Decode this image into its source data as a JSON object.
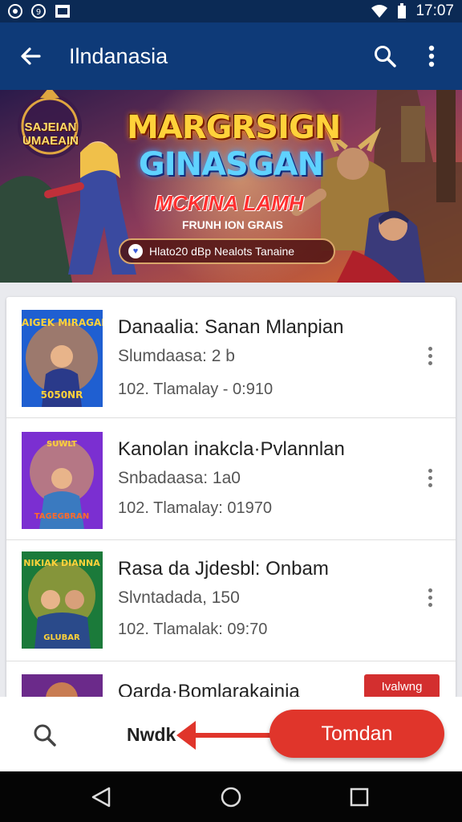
{
  "status_bar": {
    "time": "17:07",
    "left_icons": [
      "dot-icon",
      "sync-icon",
      "image-icon"
    ],
    "right_icons": [
      "wifi-icon",
      "battery-icon"
    ]
  },
  "app_bar": {
    "title": "Ilndanasia",
    "back_icon": "arrow-left-icon",
    "search_icon": "search-icon",
    "more_icon": "more-vertical-icon",
    "color": "#0e3a78"
  },
  "banner": {
    "logo_text": "SAJEIAN UMAEAIN",
    "title_line1": "MARGRSIGN",
    "title_line2": "GINASGAN",
    "subtitle1": "MCKINA LAMH",
    "subtitle2": "FRUNH ION GRAIS",
    "pill_text": "Hlato20 dBp Nealots Tanaine",
    "pill_icon": "heart-check-icon"
  },
  "list": {
    "items": [
      {
        "title": "Danaalia: Sanan Mlanpian",
        "subtitle": "Slumdaasa: 2 b",
        "meta": "102. Tlamalay - 0:910",
        "thumb_top": "RAIGEK MIRAGAN",
        "thumb_bottom": "5050NR",
        "accent": "#1f5fd1"
      },
      {
        "title": "Kanolan inakcla·Pvlannlan",
        "subtitle": "Snbadaasa: 1a0",
        "meta": "102. Tlamalay: 01970",
        "thumb_top": "SUWLT",
        "thumb_bottom": "TAGEGBRAN",
        "accent": "#7b2fd1"
      },
      {
        "title": "Rasa da Jjdesbl: Onbam",
        "subtitle": "Slvntadada, 150",
        "meta": "102. Tlamalak: 09:70",
        "thumb_top": "NIKIAK DIANNA",
        "thumb_bottom": "GLUBAR",
        "accent": "#1b7a3a"
      },
      {
        "title": "Oarda·Bomlarakainia",
        "subtitle": "",
        "meta": "",
        "thumb_top": "",
        "thumb_bottom": "",
        "accent": "#6b2a8a"
      }
    ],
    "badge": "Ivalwng"
  },
  "bottom_bar": {
    "search_icon": "search-icon",
    "label": "Nwdk",
    "arrow_icon": "arrow-left-red-icon",
    "primary_button": "Tomdan",
    "accent": "#e0352b"
  },
  "nav_bar": {
    "icons": [
      "back-triangle-icon",
      "home-circle-icon",
      "recents-square-icon"
    ]
  }
}
